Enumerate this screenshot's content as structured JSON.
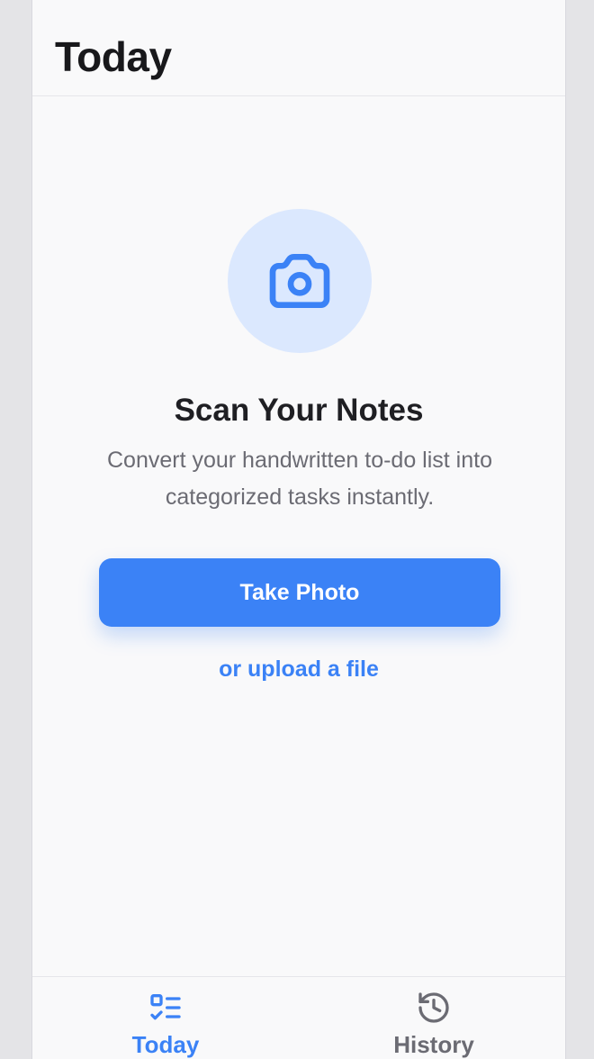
{
  "header": {
    "title": "Today"
  },
  "empty_state": {
    "icon": "camera-icon",
    "heading": "Scan Your Notes",
    "description": "Convert your handwritten to-do list into categorized tasks instantly.",
    "primary_action": "Take Photo",
    "secondary_action": "or upload a file"
  },
  "tabs": [
    {
      "label": "Today",
      "icon": "checklist-icon",
      "active": true
    },
    {
      "label": "History",
      "icon": "history-icon",
      "active": false
    }
  ],
  "colors": {
    "accent": "#3b82f6",
    "accent_light": "#dbe8fe",
    "inactive": "#6b6b73",
    "background": "#f9f9fa"
  }
}
